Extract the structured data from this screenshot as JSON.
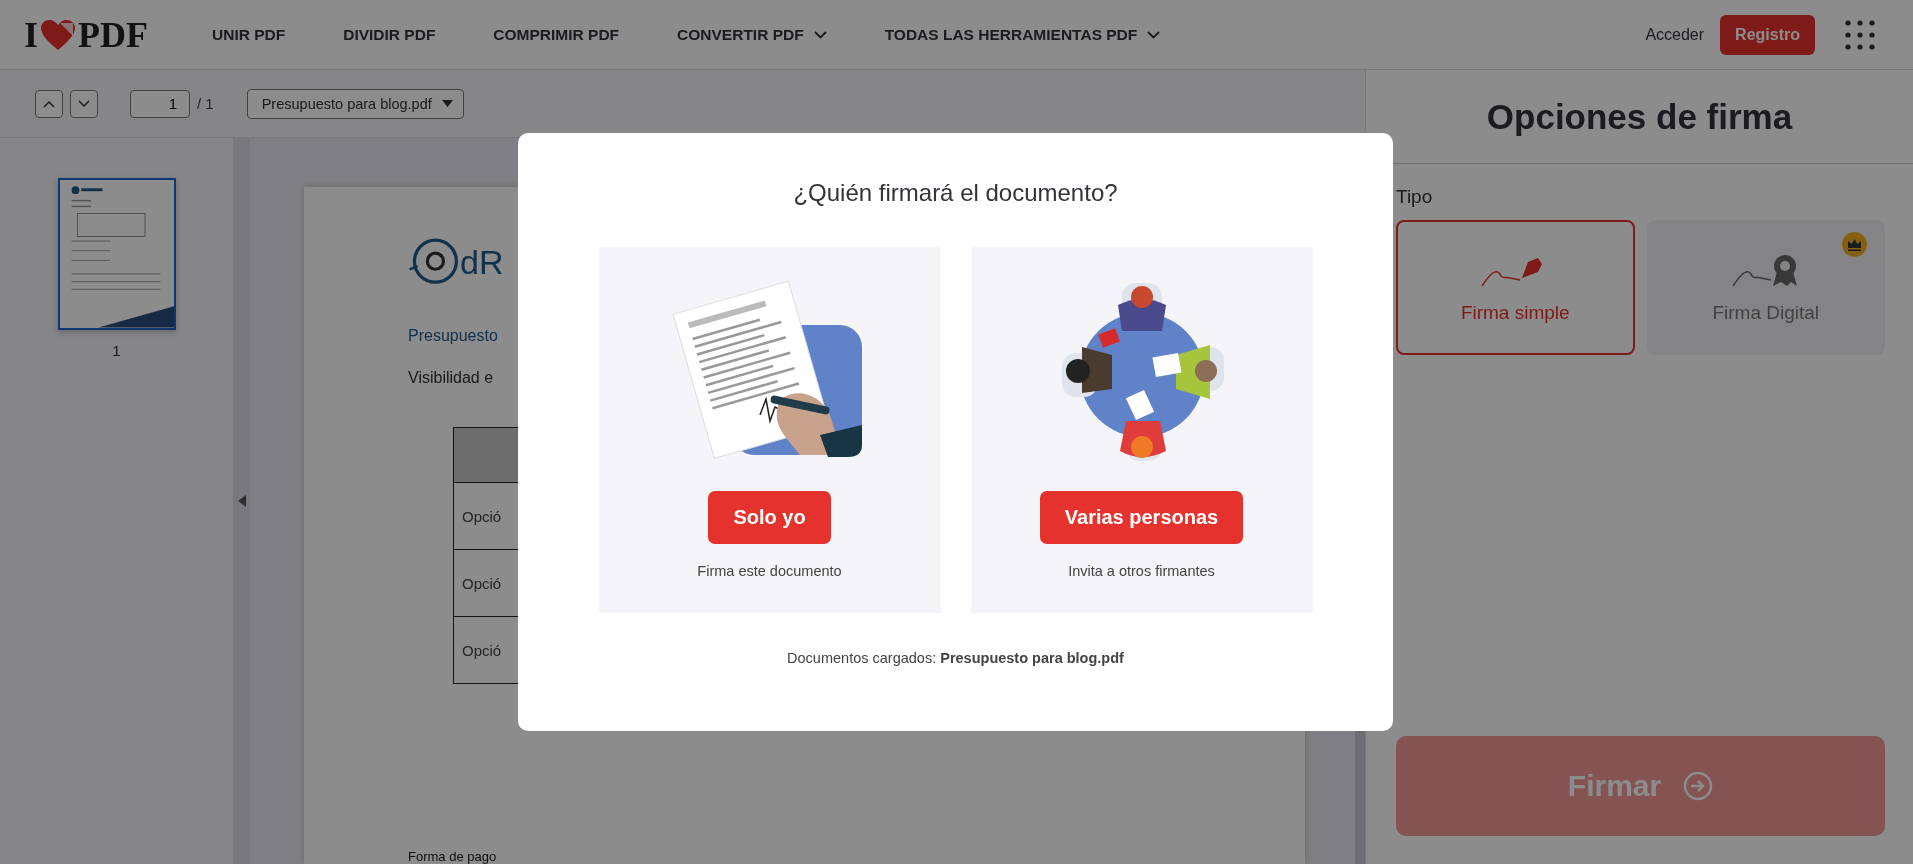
{
  "header": {
    "logo": {
      "left": "I",
      "right": "PDF"
    },
    "nav": [
      {
        "label": "UNIR PDF",
        "has_menu": false
      },
      {
        "label": "DIVIDIR PDF",
        "has_menu": false
      },
      {
        "label": "COMPRIMIR PDF",
        "has_menu": false
      },
      {
        "label": "CONVERTIR PDF",
        "has_menu": true
      },
      {
        "label": "TODAS LAS HERRAMIENTAS PDF",
        "has_menu": true
      }
    ],
    "login": "Acceder",
    "register": "Registro"
  },
  "toolbar": {
    "page_value": "1",
    "page_total": "/ 1",
    "file": "Presupuesto para blog.pdf"
  },
  "thumbnails": [
    {
      "label": "1",
      "selected": true
    }
  ],
  "document": {
    "logo_text": "dR",
    "heading": "Presupuesto",
    "subtitle": "Visibilidad e",
    "table_rows": [
      "Opció",
      "Opció",
      "Opció"
    ],
    "footer": "Forma de pago"
  },
  "sign_panel": {
    "title": "Opciones de firma",
    "type_label": "Tipo",
    "types": [
      {
        "kind": "simple",
        "label": "Firma simple",
        "selected": true,
        "premium": false
      },
      {
        "kind": "digital",
        "label": "Firma Digital",
        "selected": false,
        "premium": true
      }
    ],
    "submit": {
      "label": "Firmar",
      "disabled": true
    }
  },
  "modal": {
    "title": "¿Quién firmará el documento?",
    "options": [
      {
        "kind": "self",
        "button": "Solo yo",
        "caption": "Firma este documento"
      },
      {
        "kind": "group",
        "button": "Varias personas",
        "caption": "Invita a otros firmantes"
      }
    ],
    "footer": "Documentos cargados: **Presupuesto para blog.pdf**"
  }
}
